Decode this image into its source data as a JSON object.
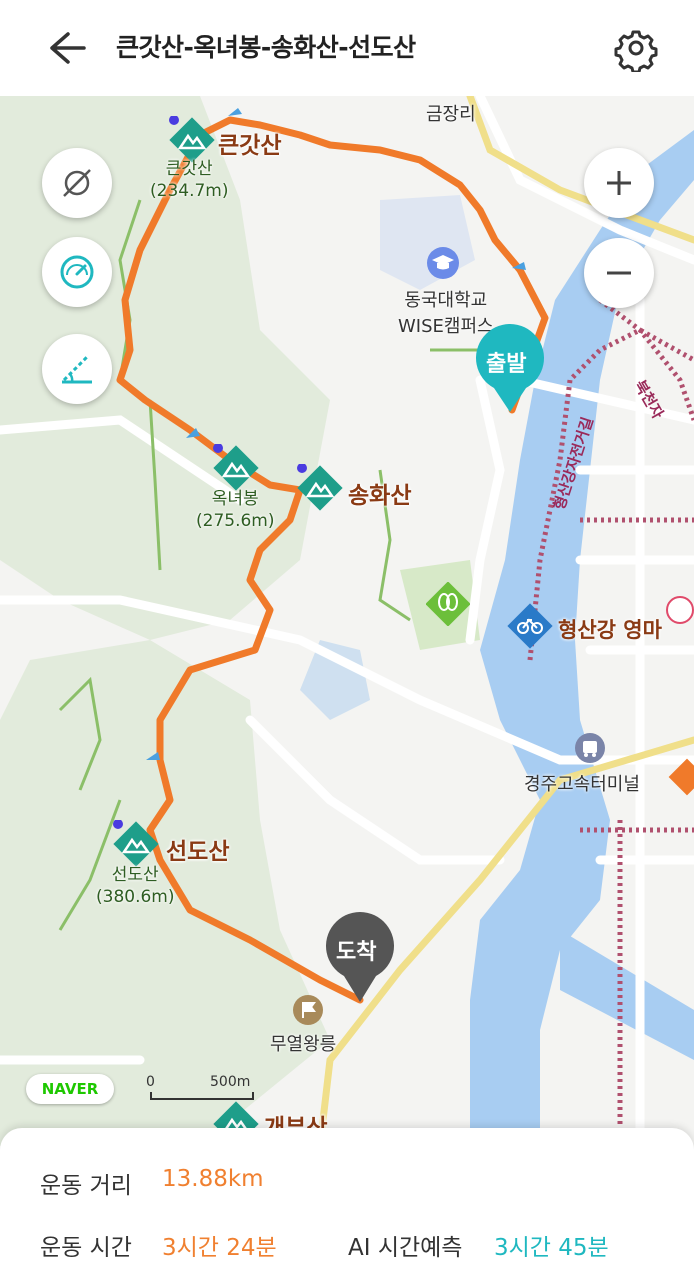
{
  "header": {
    "title": "큰갓산-옥녀봉-송화산-선도산"
  },
  "map": {
    "peaks": [
      {
        "name": "큰갓산",
        "sub_name": "큰갓산",
        "elevation": "(234.7m)"
      },
      {
        "name": "",
        "sub_name": "옥녀봉",
        "elevation": "(275.6m)"
      },
      {
        "name": "송화산",
        "sub_name": "",
        "elevation": ""
      },
      {
        "name": "선도산",
        "sub_name": "선도산",
        "elevation": "(380.6m)"
      },
      {
        "name": "개부산",
        "sub_name": "",
        "elevation": ""
      }
    ],
    "places": {
      "geumjangri": "금장리",
      "university_line1": "동국대학교",
      "university_line2": "WISE캠퍼스",
      "river_park": "형산강 영마",
      "terminal": "경주고속터미널",
      "tomb": "무열왕릉",
      "bike_road": "형산강자전거길",
      "bukcheon": "북천자"
    },
    "markers": {
      "start": "출발",
      "end": "도착"
    },
    "scale": {
      "zero": "0",
      "distance": "500m"
    },
    "logo": "NAVER",
    "route_color": "#f07a2a",
    "accent_teal": "#1fb8c0"
  },
  "stats": {
    "distance_label": "운동 거리",
    "distance_value": "13.88km",
    "time_label": "운동 시간",
    "time_value": "3시간 24분",
    "ai_label": "AI 시간예측",
    "ai_value": "3시간 45분"
  }
}
